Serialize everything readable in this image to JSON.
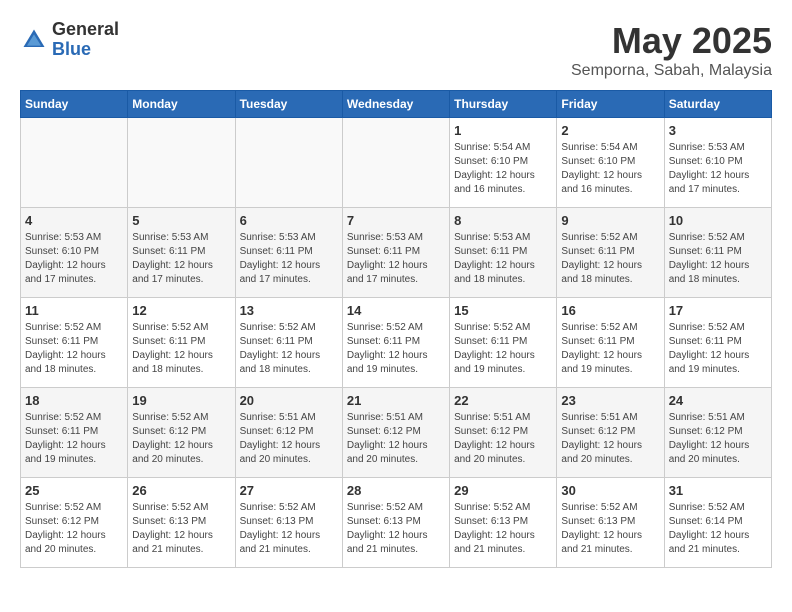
{
  "header": {
    "logo_general": "General",
    "logo_blue": "Blue",
    "month_year": "May 2025",
    "location": "Semporna, Sabah, Malaysia"
  },
  "days_of_week": [
    "Sunday",
    "Monday",
    "Tuesday",
    "Wednesday",
    "Thursday",
    "Friday",
    "Saturday"
  ],
  "weeks": [
    [
      {
        "day": "",
        "info": ""
      },
      {
        "day": "",
        "info": ""
      },
      {
        "day": "",
        "info": ""
      },
      {
        "day": "",
        "info": ""
      },
      {
        "day": "1",
        "info": "Sunrise: 5:54 AM\nSunset: 6:10 PM\nDaylight: 12 hours\nand 16 minutes."
      },
      {
        "day": "2",
        "info": "Sunrise: 5:54 AM\nSunset: 6:10 PM\nDaylight: 12 hours\nand 16 minutes."
      },
      {
        "day": "3",
        "info": "Sunrise: 5:53 AM\nSunset: 6:10 PM\nDaylight: 12 hours\nand 17 minutes."
      }
    ],
    [
      {
        "day": "4",
        "info": "Sunrise: 5:53 AM\nSunset: 6:10 PM\nDaylight: 12 hours\nand 17 minutes."
      },
      {
        "day": "5",
        "info": "Sunrise: 5:53 AM\nSunset: 6:11 PM\nDaylight: 12 hours\nand 17 minutes."
      },
      {
        "day": "6",
        "info": "Sunrise: 5:53 AM\nSunset: 6:11 PM\nDaylight: 12 hours\nand 17 minutes."
      },
      {
        "day": "7",
        "info": "Sunrise: 5:53 AM\nSunset: 6:11 PM\nDaylight: 12 hours\nand 17 minutes."
      },
      {
        "day": "8",
        "info": "Sunrise: 5:53 AM\nSunset: 6:11 PM\nDaylight: 12 hours\nand 18 minutes."
      },
      {
        "day": "9",
        "info": "Sunrise: 5:52 AM\nSunset: 6:11 PM\nDaylight: 12 hours\nand 18 minutes."
      },
      {
        "day": "10",
        "info": "Sunrise: 5:52 AM\nSunset: 6:11 PM\nDaylight: 12 hours\nand 18 minutes."
      }
    ],
    [
      {
        "day": "11",
        "info": "Sunrise: 5:52 AM\nSunset: 6:11 PM\nDaylight: 12 hours\nand 18 minutes."
      },
      {
        "day": "12",
        "info": "Sunrise: 5:52 AM\nSunset: 6:11 PM\nDaylight: 12 hours\nand 18 minutes."
      },
      {
        "day": "13",
        "info": "Sunrise: 5:52 AM\nSunset: 6:11 PM\nDaylight: 12 hours\nand 18 minutes."
      },
      {
        "day": "14",
        "info": "Sunrise: 5:52 AM\nSunset: 6:11 PM\nDaylight: 12 hours\nand 19 minutes."
      },
      {
        "day": "15",
        "info": "Sunrise: 5:52 AM\nSunset: 6:11 PM\nDaylight: 12 hours\nand 19 minutes."
      },
      {
        "day": "16",
        "info": "Sunrise: 5:52 AM\nSunset: 6:11 PM\nDaylight: 12 hours\nand 19 minutes."
      },
      {
        "day": "17",
        "info": "Sunrise: 5:52 AM\nSunset: 6:11 PM\nDaylight: 12 hours\nand 19 minutes."
      }
    ],
    [
      {
        "day": "18",
        "info": "Sunrise: 5:52 AM\nSunset: 6:11 PM\nDaylight: 12 hours\nand 19 minutes."
      },
      {
        "day": "19",
        "info": "Sunrise: 5:52 AM\nSunset: 6:12 PM\nDaylight: 12 hours\nand 20 minutes."
      },
      {
        "day": "20",
        "info": "Sunrise: 5:51 AM\nSunset: 6:12 PM\nDaylight: 12 hours\nand 20 minutes."
      },
      {
        "day": "21",
        "info": "Sunrise: 5:51 AM\nSunset: 6:12 PM\nDaylight: 12 hours\nand 20 minutes."
      },
      {
        "day": "22",
        "info": "Sunrise: 5:51 AM\nSunset: 6:12 PM\nDaylight: 12 hours\nand 20 minutes."
      },
      {
        "day": "23",
        "info": "Sunrise: 5:51 AM\nSunset: 6:12 PM\nDaylight: 12 hours\nand 20 minutes."
      },
      {
        "day": "24",
        "info": "Sunrise: 5:51 AM\nSunset: 6:12 PM\nDaylight: 12 hours\nand 20 minutes."
      }
    ],
    [
      {
        "day": "25",
        "info": "Sunrise: 5:52 AM\nSunset: 6:12 PM\nDaylight: 12 hours\nand 20 minutes."
      },
      {
        "day": "26",
        "info": "Sunrise: 5:52 AM\nSunset: 6:13 PM\nDaylight: 12 hours\nand 21 minutes."
      },
      {
        "day": "27",
        "info": "Sunrise: 5:52 AM\nSunset: 6:13 PM\nDaylight: 12 hours\nand 21 minutes."
      },
      {
        "day": "28",
        "info": "Sunrise: 5:52 AM\nSunset: 6:13 PM\nDaylight: 12 hours\nand 21 minutes."
      },
      {
        "day": "29",
        "info": "Sunrise: 5:52 AM\nSunset: 6:13 PM\nDaylight: 12 hours\nand 21 minutes."
      },
      {
        "day": "30",
        "info": "Sunrise: 5:52 AM\nSunset: 6:13 PM\nDaylight: 12 hours\nand 21 minutes."
      },
      {
        "day": "31",
        "info": "Sunrise: 5:52 AM\nSunset: 6:14 PM\nDaylight: 12 hours\nand 21 minutes."
      }
    ]
  ]
}
